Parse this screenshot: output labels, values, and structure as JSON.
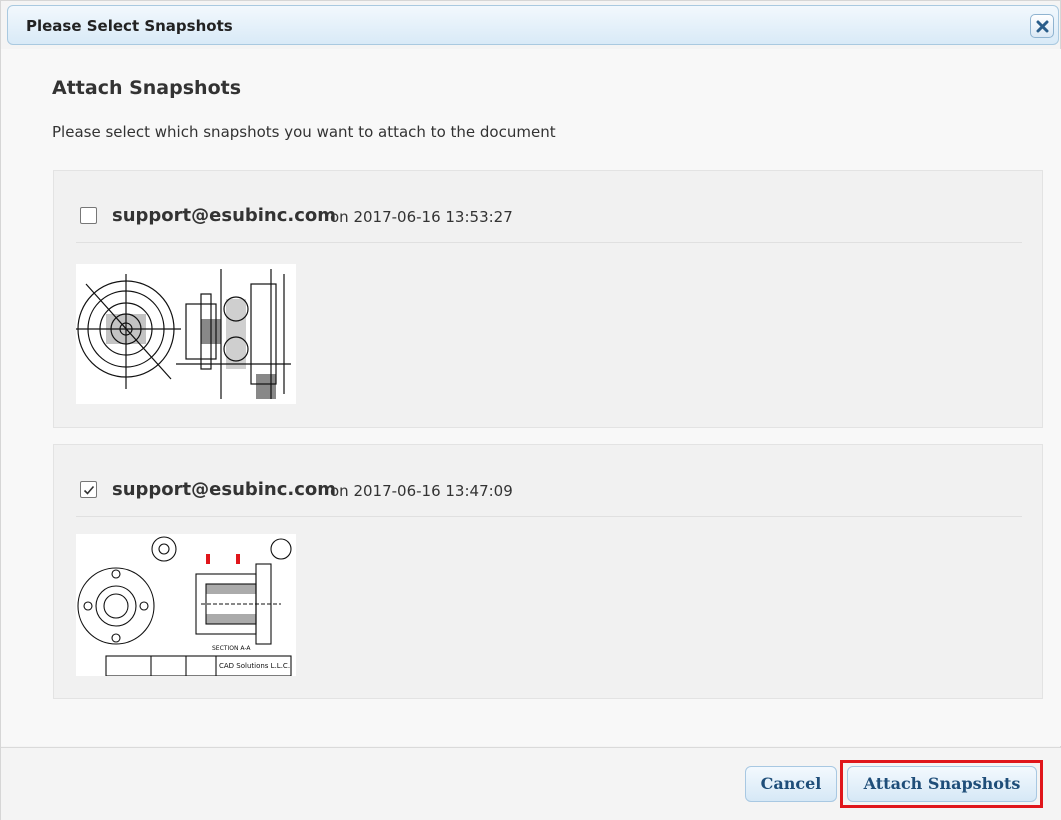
{
  "dialog": {
    "title": "Please Select Snapshots",
    "close_icon": "close-icon"
  },
  "content": {
    "heading": "Attach Snapshots",
    "instructions": "Please select which snapshots you want to attach to the document"
  },
  "snapshots": [
    {
      "user": "support@esubinc.com",
      "date": "on 2017-06-16 13:53:27",
      "checked": false
    },
    {
      "user": "support@esubinc.com",
      "date": "on 2017-06-16 13:47:09",
      "checked": true,
      "drawing_label_1": "SECTION A-A",
      "drawing_label_2": "CAD Solutions L.L.C."
    }
  ],
  "footer": {
    "cancel_label": "Cancel",
    "attach_label": "Attach Snapshots"
  },
  "colors": {
    "highlight": "#e0161b",
    "button_text": "#1f4e79"
  }
}
